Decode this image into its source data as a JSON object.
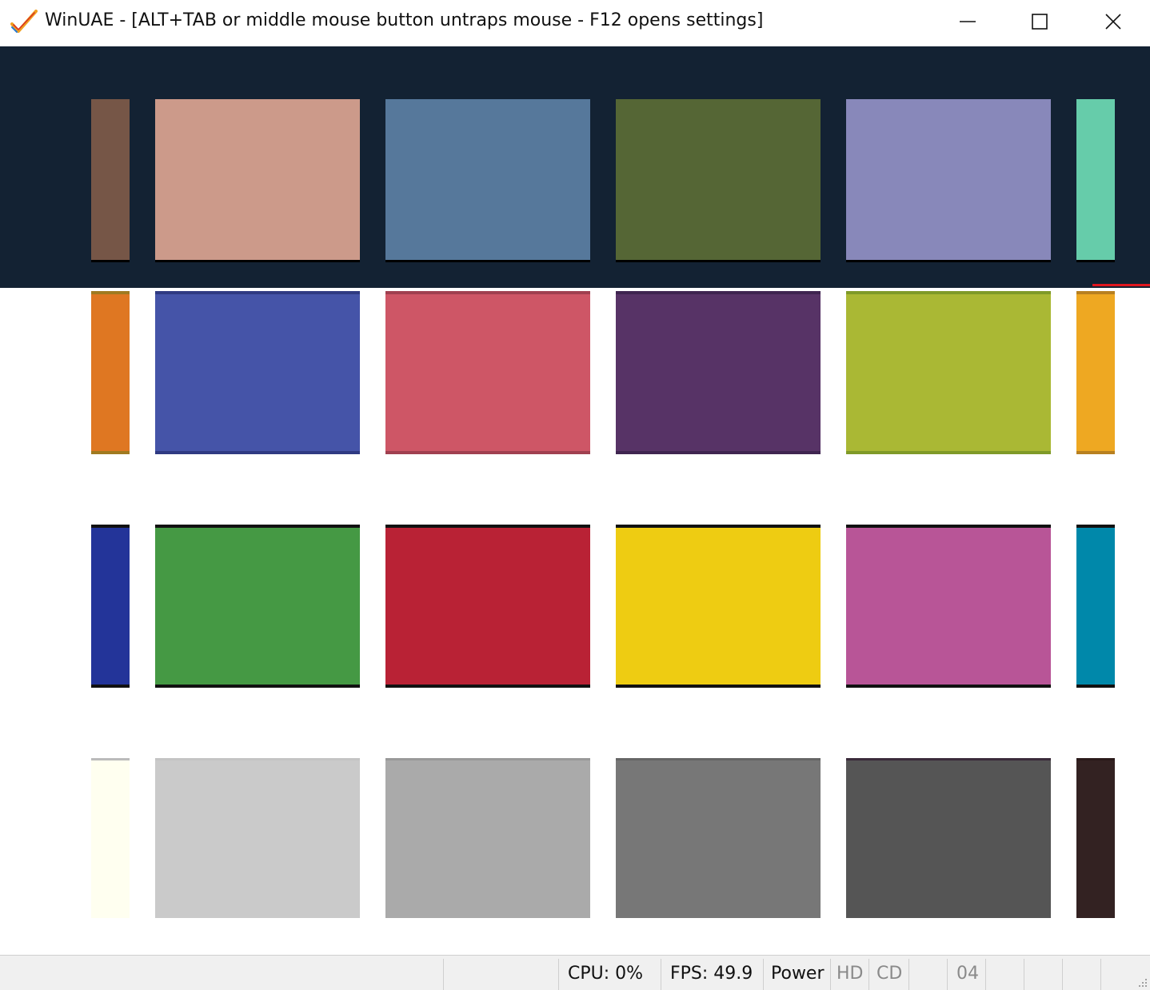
{
  "window": {
    "title": "WinUAE - [ALT+TAB or middle mouse button untraps mouse - F12 opens settings]"
  },
  "icons": {
    "app": "winuae-checkmark-icon",
    "minimize": "minimize-icon",
    "maximize": "maximize-icon",
    "close": "close-icon",
    "grip": "resize-grip-icon"
  },
  "palette": {
    "background_dark": "#132233",
    "background_light": "#ffffff",
    "marker_red": "#e0161e",
    "rows": [
      [
        "#765647",
        "#cc9a8a",
        "#56789b",
        "#556635",
        "#8888ba",
        "#66ccaa"
      ],
      [
        "#df7722",
        "#4554a8",
        "#ce5666",
        "#573366",
        "#aab834",
        "#eea822"
      ],
      [
        "#233499",
        "#459944",
        "#b92235",
        "#eecc12",
        "#b85597",
        "#0088aa"
      ],
      [
        "#fffff0",
        "#cacaca",
        "#aaaaaa",
        "#777777",
        "#555555",
        "#332222"
      ]
    ],
    "shadows": [
      [
        "#000000",
        "#000000",
        "#000000",
        "#000000",
        "#000000",
        "#000000"
      ],
      [
        "#a07a20",
        "#2f3a82",
        "#a04050",
        "#3f2550",
        "#7f9a28",
        "#b88020"
      ],
      [
        "#111111",
        "#111111",
        "#111111",
        "#111111",
        "#111111",
        "#111111"
      ],
      [
        "#bbbbbb",
        "#c4c4c4",
        "#999999",
        "#666666",
        "#3a2a3a",
        "#2a1a1a"
      ]
    ]
  },
  "status": {
    "cpu": "CPU: 0%",
    "fps": "FPS: 49.9",
    "power": "Power",
    "hd": "HD",
    "cd": "CD",
    "drive": "04"
  }
}
